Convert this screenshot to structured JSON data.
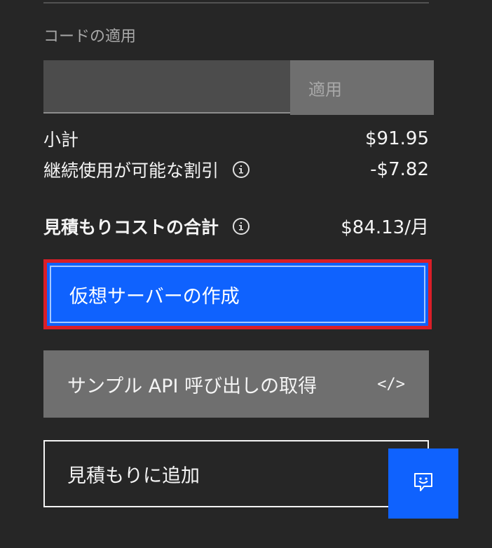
{
  "code_section": {
    "label": "コードの適用",
    "input_value": "",
    "apply_label": "適用"
  },
  "summary": {
    "subtotal_label": "小計",
    "subtotal_value": "$91.95",
    "discount_label": "継続使用が可能な割引",
    "discount_value": "-$7.82",
    "total_label": "見積もりコストの合計",
    "total_value": "$84.13/月"
  },
  "actions": {
    "create_vm_label": "仮想サーバーの作成",
    "api_label": "サンプル API 呼び出しの取得",
    "api_icon_glyph": "</>",
    "add_estimate_label": "見積もりに追加"
  },
  "icons": {
    "info": "info-icon",
    "code": "code-icon",
    "chat": "chat-bot-icon"
  },
  "colors": {
    "background": "#262626",
    "primary": "#0f62fe",
    "secondary": "#6f6f6f",
    "highlight": "#da1e28"
  }
}
